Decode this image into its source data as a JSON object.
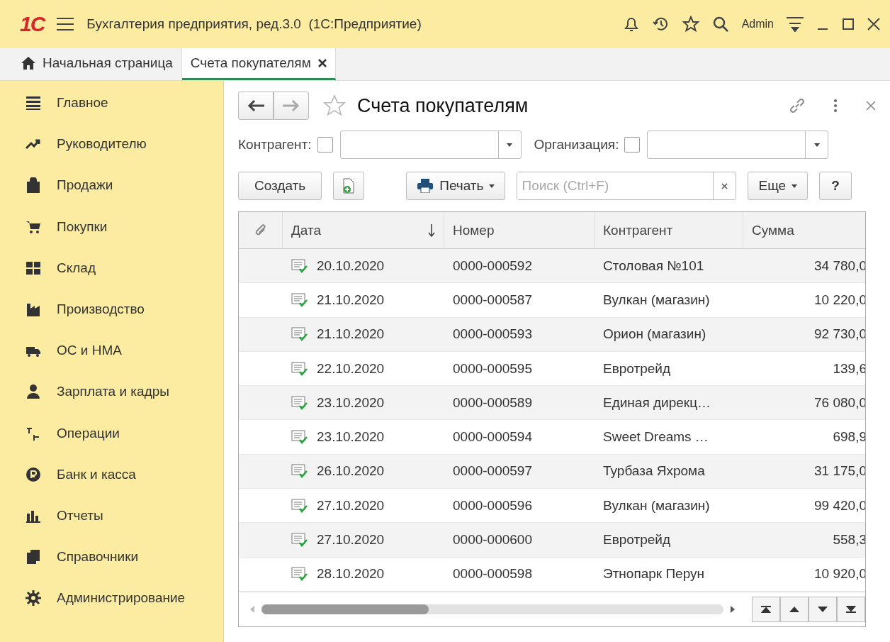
{
  "window": {
    "logo": "1С",
    "title": "Бухгалтерия предприятия, ред.3.0  (1С:Предприятие)",
    "user": "Admin"
  },
  "tabs": [
    {
      "label": "Начальная страница",
      "selected": false
    },
    {
      "label": "Счета покупателям",
      "selected": true
    }
  ],
  "sidebar": {
    "items": [
      {
        "label": "Главное"
      },
      {
        "label": "Руководителю"
      },
      {
        "label": "Продажи"
      },
      {
        "label": "Покупки"
      },
      {
        "label": "Склад"
      },
      {
        "label": "Производство"
      },
      {
        "label": "ОС и НМА"
      },
      {
        "label": "Зарплата и кадры"
      },
      {
        "label": "Операции"
      },
      {
        "label": "Банк и касса"
      },
      {
        "label": "Отчеты"
      },
      {
        "label": "Справочники"
      },
      {
        "label": "Администрирование"
      }
    ]
  },
  "form": {
    "title": "Счета покупателям",
    "filters": [
      {
        "label": "Контрагент:",
        "checked": false
      },
      {
        "label": "Организация:",
        "checked": false
      }
    ],
    "toolbar": {
      "create": "Создать",
      "print": "Печать",
      "search_placeholder": "Поиск (Ctrl+F)",
      "more": "Еще",
      "help": "?"
    },
    "table": {
      "columns": [
        "Дата",
        "Номер",
        "Контрагент",
        "Сумма"
      ],
      "rows": [
        {
          "date": "20.10.2020",
          "number": "0000-000592",
          "counterparty": "Столовая №101",
          "sum": "34 780,0",
          "posted": true
        },
        {
          "date": "21.10.2020",
          "number": "0000-000587",
          "counterparty": "Вулкан (магазин)",
          "sum": "10 220,0",
          "posted": true
        },
        {
          "date": "21.10.2020",
          "number": "0000-000593",
          "counterparty": "Орион (магазин)",
          "sum": "92 730,0",
          "posted": true
        },
        {
          "date": "22.10.2020",
          "number": "0000-000595",
          "counterparty": "Евротрейд",
          "sum": "139,6",
          "posted": true
        },
        {
          "date": "23.10.2020",
          "number": "0000-000589",
          "counterparty": "Единая дирекц…",
          "sum": "76 080,0",
          "posted": true
        },
        {
          "date": "23.10.2020",
          "number": "0000-000594",
          "counterparty": "Sweet Dreams …",
          "sum": "698,9",
          "posted": true
        },
        {
          "date": "26.10.2020",
          "number": "0000-000597",
          "counterparty": "Турбаза Яхрома",
          "sum": "31 175,0",
          "posted": true
        },
        {
          "date": "27.10.2020",
          "number": "0000-000596",
          "counterparty": "Вулкан (магазин)",
          "sum": "99 420,0",
          "posted": true
        },
        {
          "date": "27.10.2020",
          "number": "0000-000600",
          "counterparty": "Евротрейд",
          "sum": "558,3",
          "posted": true
        },
        {
          "date": "28.10.2020",
          "number": "0000-000598",
          "counterparty": "Этнопарк Перун",
          "sum": "10 920,0",
          "posted": true
        }
      ]
    }
  }
}
